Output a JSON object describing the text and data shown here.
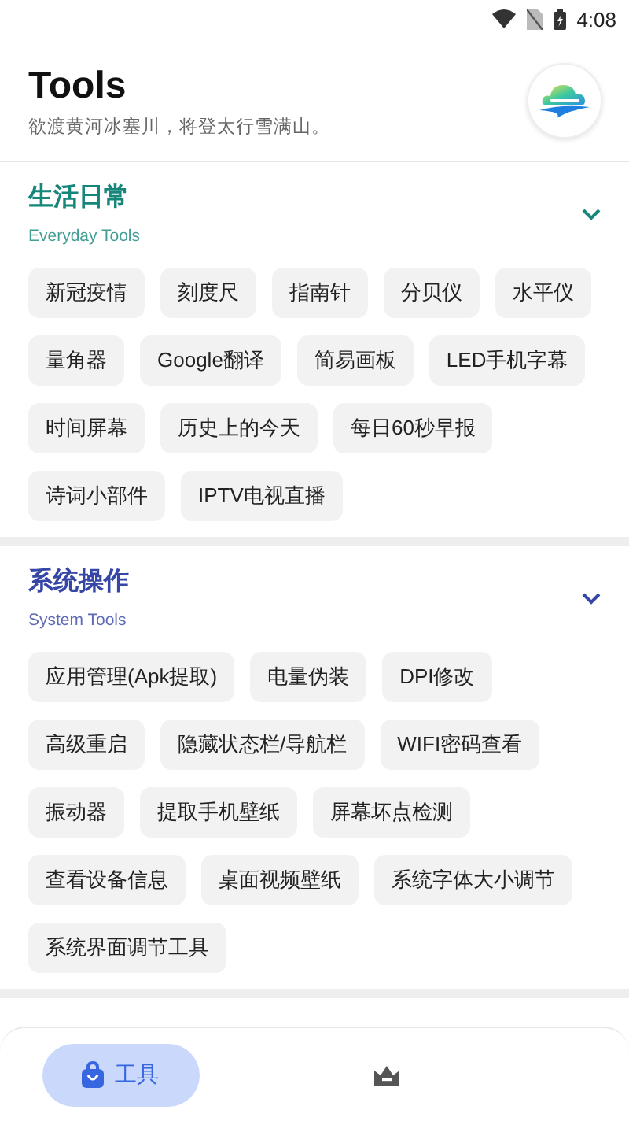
{
  "status_bar": {
    "time": "4:08"
  },
  "header": {
    "title": "Tools",
    "subtitle": "欲渡黄河冰塞川，将登太行雪满山。"
  },
  "sections": [
    {
      "title": "生活日常",
      "subtitle": "Everyday Tools",
      "color": "#16867a",
      "expanded": true,
      "items": [
        "新冠疫情",
        "刻度尺",
        "指南针",
        "分贝仪",
        "水平仪",
        "量角器",
        "Google翻译",
        "简易画板",
        "LED手机字幕",
        "时间屏幕",
        "历史上的今天",
        "每日60秒早报",
        "诗词小部件",
        "IPTV电视直播"
      ]
    },
    {
      "title": "系统操作",
      "subtitle": "System Tools",
      "color": "#3646a6",
      "expanded": true,
      "items": [
        "应用管理(Apk提取)",
        "电量伪装",
        "DPI修改",
        "高级重启",
        "隐藏状态栏/导航栏",
        "WIFI密码查看",
        "振动器",
        "提取手机壁纸",
        "屏幕坏点检测",
        "查看设备信息",
        "桌面视频壁纸",
        "系统字体大小调节",
        "系统界面调节工具"
      ]
    }
  ],
  "bottom_nav": [
    {
      "kind": "bag",
      "label": "工具",
      "selected": true
    },
    {
      "kind": "crown",
      "selected": false
    }
  ]
}
